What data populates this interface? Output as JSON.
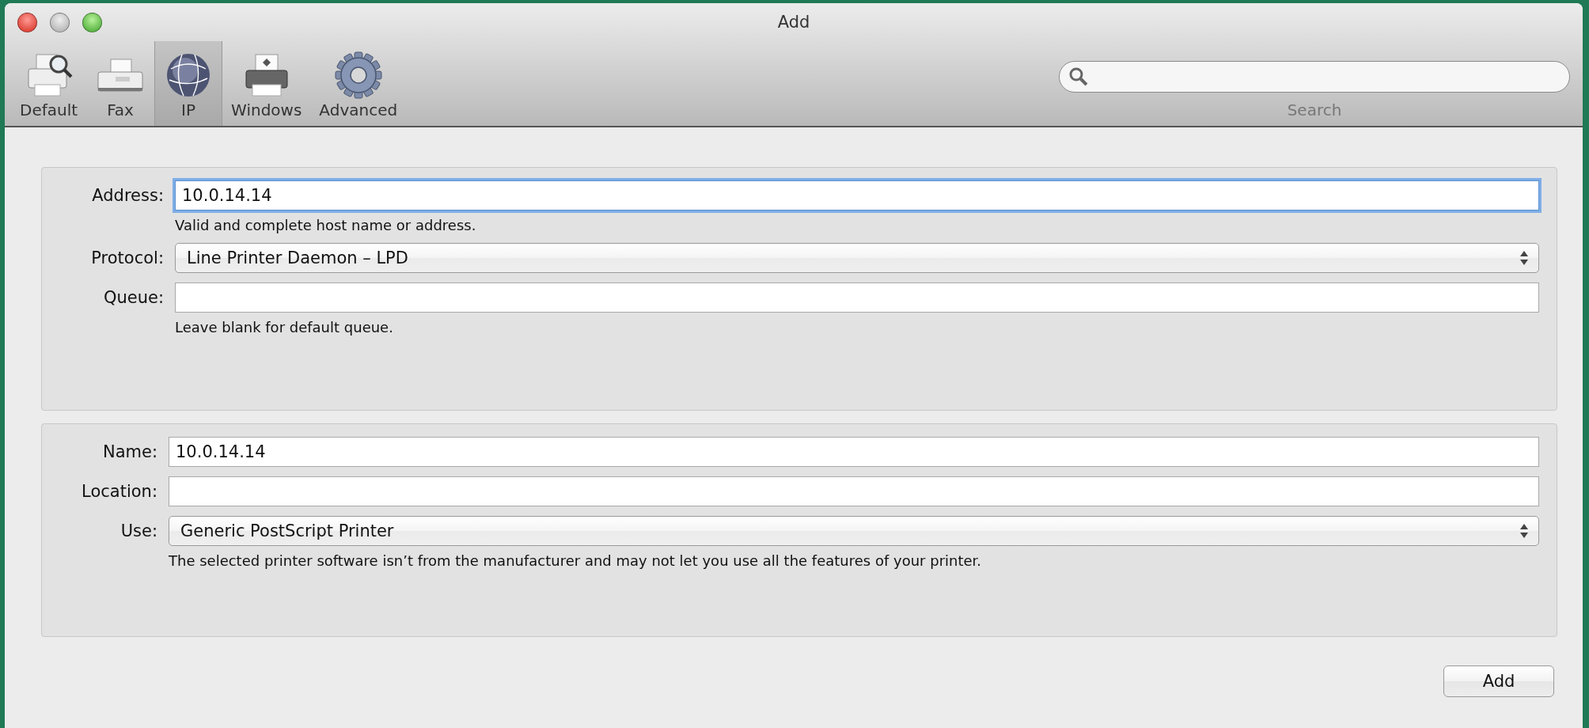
{
  "window": {
    "title": "Add"
  },
  "toolbar": {
    "items": [
      {
        "label": "Default",
        "kind": "printer-search",
        "selected": false
      },
      {
        "label": "Fax",
        "kind": "fax",
        "selected": false
      },
      {
        "label": "IP",
        "kind": "globe",
        "selected": true
      },
      {
        "label": "Windows",
        "kind": "printer-windows",
        "selected": false
      },
      {
        "label": "Advanced",
        "kind": "gear",
        "selected": false
      }
    ],
    "search": {
      "label": "Search"
    }
  },
  "sections": [
    {
      "fields": [
        {
          "kind": "text",
          "label": "Address:",
          "value": "10.0.14.14",
          "focused": true,
          "hint": "Valid and complete host name or address."
        },
        {
          "kind": "popup",
          "label": "Protocol:",
          "value": "Line Printer Daemon – LPD"
        },
        {
          "kind": "text",
          "label": "Queue:",
          "focused": false,
          "hint": "Leave blank for default queue."
        }
      ]
    },
    {
      "fields": [
        {
          "kind": "text",
          "label": "Name:",
          "value": "10.0.14.14",
          "focused": false
        },
        {
          "kind": "text",
          "label": "Location:",
          "focused": false
        },
        {
          "kind": "popup",
          "label": "Use:",
          "value": "Generic PostScript Printer",
          "hint": "The selected printer software isn’t from the manufacturer and may not let you use all the features of your printer."
        }
      ]
    }
  ],
  "buttons": [
    {
      "label": "Add"
    }
  ]
}
